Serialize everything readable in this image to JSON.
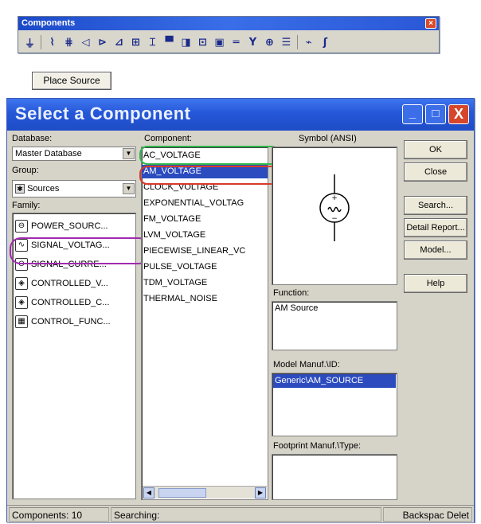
{
  "toolbar": {
    "title": "Components",
    "close": "×",
    "icons": [
      {
        "name": "ground-icon",
        "glyph": "⏚"
      },
      {
        "name": "resistor-icon",
        "glyph": "⌇"
      },
      {
        "name": "coil-icon",
        "glyph": "⋕"
      },
      {
        "name": "diode-icon",
        "glyph": "◁"
      },
      {
        "name": "transistor-icon",
        "glyph": "⊳"
      },
      {
        "name": "analog-icon",
        "glyph": "⊿"
      },
      {
        "name": "ttl-icon",
        "glyph": "⊞"
      },
      {
        "name": "cmos-icon",
        "glyph": "⌶"
      },
      {
        "name": "mcu-icon",
        "glyph": "▀"
      },
      {
        "name": "advanced-peripherals-icon",
        "glyph": "◨"
      },
      {
        "name": "misc-digital-icon",
        "glyph": "⊡"
      },
      {
        "name": "mixed-icon",
        "glyph": "▣"
      },
      {
        "name": "indicator-icon",
        "glyph": "═"
      },
      {
        "name": "power-component-icon",
        "glyph": "Y"
      },
      {
        "name": "misc-icon",
        "glyph": "⊕"
      },
      {
        "name": "rf-icon",
        "glyph": "☰"
      },
      {
        "name": "electromechanical-icon",
        "glyph": "⌁"
      },
      {
        "name": "ladder-icon",
        "glyph": "ʃ"
      }
    ]
  },
  "place_source": "Place Source",
  "dialog": {
    "title": "Select a Component",
    "minimize": "_",
    "maximize": "□",
    "close": "X",
    "database_label": "Database:",
    "database_value": "Master Database",
    "group_label": "Group:",
    "group_value": "Sources",
    "family_label": "Family:",
    "families": [
      {
        "label": "POWER_SOURC...",
        "icon": "power-source-icon",
        "glyph": "⊖"
      },
      {
        "label": "SIGNAL_VOLTAG...",
        "icon": "signal-voltage-icon",
        "glyph": "∿"
      },
      {
        "label": "SIGNAL_CURRE...",
        "icon": "signal-current-icon",
        "glyph": "⊙"
      },
      {
        "label": "CONTROLLED_V...",
        "icon": "controlled-voltage-icon",
        "glyph": "◈"
      },
      {
        "label": "CONTROLLED_C...",
        "icon": "controlled-current-icon",
        "glyph": "◈"
      },
      {
        "label": "CONTROL_FUNC...",
        "icon": "control-function-icon",
        "glyph": "▦"
      }
    ],
    "component_label": "Component:",
    "components": [
      "AC_VOLTAGE",
      "AM_VOLTAGE",
      "CLOCK_VOLTAGE",
      "EXPONENTIAL_VOLTAG",
      "FM_VOLTAGE",
      "LVM_VOLTAGE",
      "PIECEWISE_LINEAR_VC",
      "PULSE_VOLTAGE",
      "TDM_VOLTAGE",
      "THERMAL_NOISE"
    ],
    "selected_component_index": 1,
    "symbol_label": "Symbol (ANSI)",
    "function_label": "Function:",
    "function_value": "AM Source",
    "model_label": "Model Manuf.\\ID:",
    "model_value": "Generic\\AM_SOURCE",
    "footprint_label": "Footprint Manuf.\\Type:",
    "buttons": {
      "ok": "OK",
      "close": "Close",
      "search": "Search...",
      "detail_report": "Detail Report...",
      "model": "Model...",
      "help": "Help"
    },
    "status": {
      "components": "Components: 10",
      "searching": "Searching:",
      "hint": "Backspac Delet"
    },
    "highlight_colors": {
      "green": "#2fb84a",
      "red": "#d83a2a",
      "purple": "#a02ab0"
    }
  }
}
